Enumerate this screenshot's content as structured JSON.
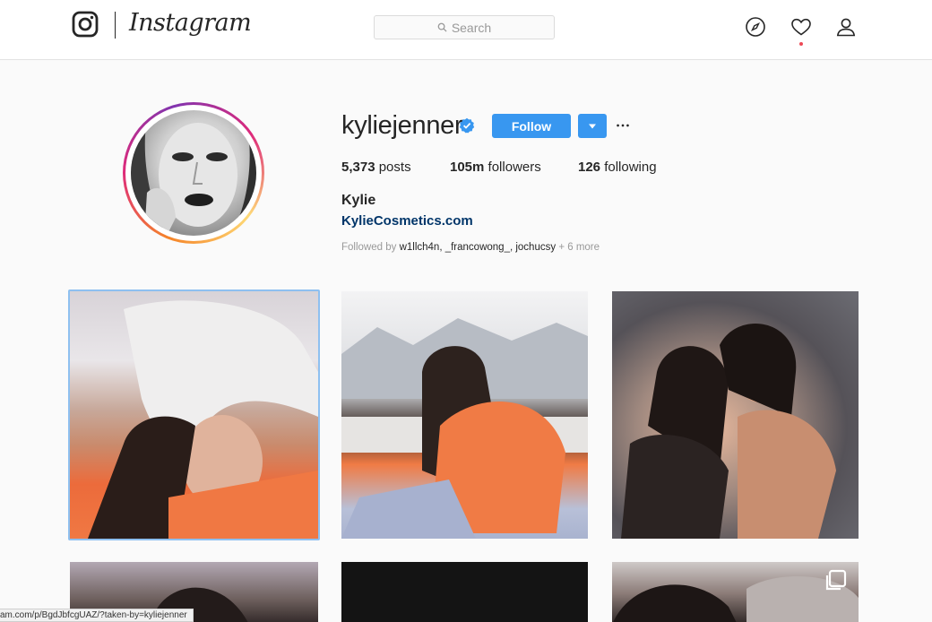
{
  "nav": {
    "logo_icon": "instagram-glyph-icon",
    "wordmark": "Instagram",
    "search_placeholder": "Search",
    "icons": [
      "compass-icon",
      "heart-icon",
      "person-icon"
    ],
    "notification_dot_color": "#ed4956"
  },
  "profile": {
    "username": "kyliejenner",
    "verified_icon": "verified-badge-icon",
    "follow_label": "Follow",
    "dropdown_icon": "caret-down-icon",
    "more_icon": "ellipsis-icon",
    "stats": {
      "posts_count": "5,373",
      "posts_label": "posts",
      "followers_count": "105m",
      "followers_label": "followers",
      "following_count": "126",
      "following_label": "following"
    },
    "full_name": "Kylie",
    "website": "KylieCosmetics.com",
    "followed_by": {
      "prefix": "Followed by",
      "users": "w1llch4n, _francowong_, jochucsy",
      "suffix": "+ 6 more"
    }
  },
  "grid": {
    "multi_post_icon": "carousel-icon",
    "selected_index": 0
  },
  "status_bar": {
    "url": "am.com/p/BgdJbfcgUAZ/?taken-by=kyliejenner"
  },
  "colors": {
    "accent": "#3897f0",
    "link": "#003569",
    "text": "#262626",
    "muted": "#999999",
    "background": "#fafafa"
  }
}
